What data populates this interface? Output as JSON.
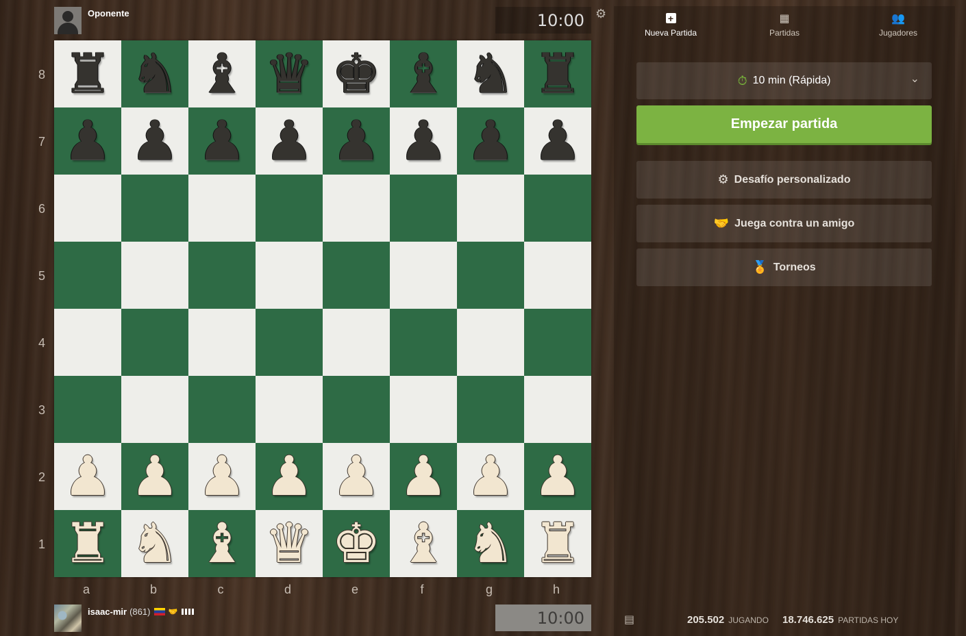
{
  "opponent": {
    "name": "Oponente",
    "clock": "10:00"
  },
  "player": {
    "name": "isaac-mir",
    "rating": "(861)",
    "clock": "10:00"
  },
  "board": {
    "ranks": [
      "8",
      "7",
      "6",
      "5",
      "4",
      "3",
      "2",
      "1"
    ],
    "files": [
      "a",
      "b",
      "c",
      "d",
      "e",
      "f",
      "g",
      "h"
    ],
    "position": [
      [
        "r",
        "n",
        "b",
        "q",
        "k",
        "b",
        "n",
        "r"
      ],
      [
        "p",
        "p",
        "p",
        "p",
        "p",
        "p",
        "p",
        "p"
      ],
      [
        "",
        "",
        "",
        "",
        "",
        "",
        "",
        ""
      ],
      [
        "",
        "",
        "",
        "",
        "",
        "",
        "",
        ""
      ],
      [
        "",
        "",
        "",
        "",
        "",
        "",
        "",
        ""
      ],
      [
        "",
        "",
        "",
        "",
        "",
        "",
        "",
        ""
      ],
      [
        "P",
        "P",
        "P",
        "P",
        "P",
        "P",
        "P",
        "P"
      ],
      [
        "R",
        "N",
        "B",
        "Q",
        "K",
        "B",
        "N",
        "R"
      ]
    ],
    "colors": {
      "light": "#eeeeea",
      "dark": "#2e6b45"
    }
  },
  "tabs": [
    {
      "label": "Nueva Partida",
      "icon": "plus-icon",
      "active": true
    },
    {
      "label": "Partidas",
      "icon": "board-icon",
      "active": false
    },
    {
      "label": "Jugadores",
      "icon": "players-icon",
      "active": false
    }
  ],
  "time_control": {
    "label": "10 min (Rápida)",
    "icon": "stopwatch-icon"
  },
  "start_button": {
    "label": "Empezar partida",
    "color": "#7cb342"
  },
  "options": [
    {
      "label": "Desafío personalizado",
      "icon": "custom-challenge-icon"
    },
    {
      "label": "Juega contra un amigo",
      "icon": "handshake-icon"
    },
    {
      "label": "Torneos",
      "icon": "medal-icon"
    }
  ],
  "stats": {
    "playing_count": "205.502",
    "playing_label": "JUGANDO",
    "games_today_count": "18.746.625",
    "games_today_label": "PARTIDAS HOY"
  }
}
